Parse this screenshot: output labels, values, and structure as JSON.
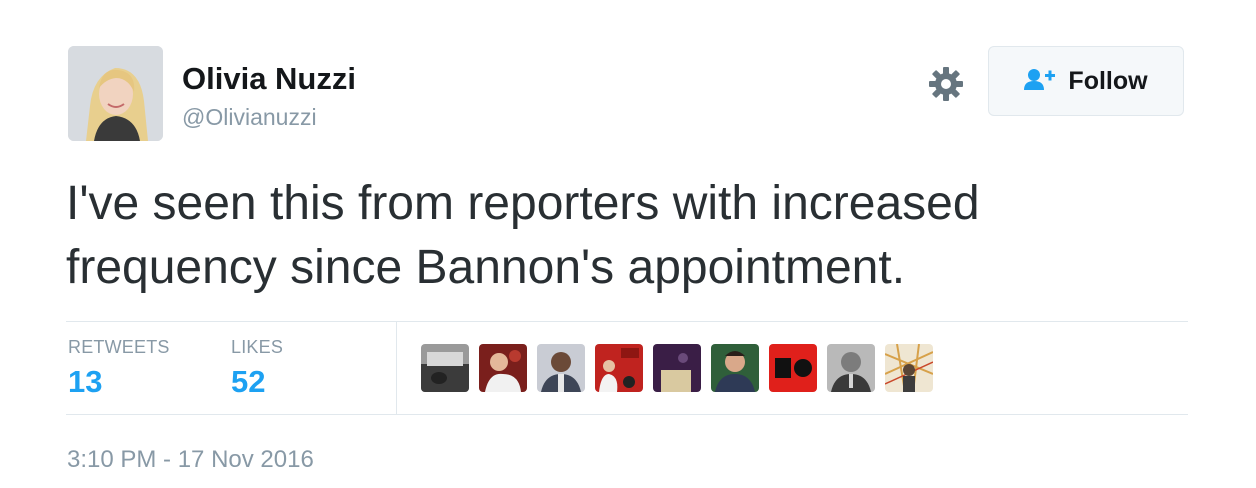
{
  "author": {
    "name": "Olivia Nuzzi",
    "handle": "@Olivianuzzi"
  },
  "actions": {
    "settings_icon": "gear-icon",
    "follow_icon": "add-person-icon",
    "follow_label": "Follow"
  },
  "tweet": {
    "text_line1": "I've seen this from reporters with increased",
    "text_line2": "frequency since Bannon's appointment.",
    "timestamp": "3:10 PM - 17 Nov 2016"
  },
  "stats": {
    "retweets_label": "RETWEETS",
    "retweets_count": "13",
    "likes_label": "LIKES",
    "likes_count": "52"
  },
  "likers": [
    {
      "name": "liker-avatar-1"
    },
    {
      "name": "liker-avatar-2"
    },
    {
      "name": "liker-avatar-3"
    },
    {
      "name": "liker-avatar-4"
    },
    {
      "name": "liker-avatar-5"
    },
    {
      "name": "liker-avatar-6"
    },
    {
      "name": "liker-avatar-7"
    },
    {
      "name": "liker-avatar-8"
    },
    {
      "name": "liker-avatar-9"
    }
  ],
  "colors": {
    "accent": "#1da1f2",
    "muted": "#8899a6",
    "text": "#292f33",
    "border": "#e1e8ed"
  }
}
